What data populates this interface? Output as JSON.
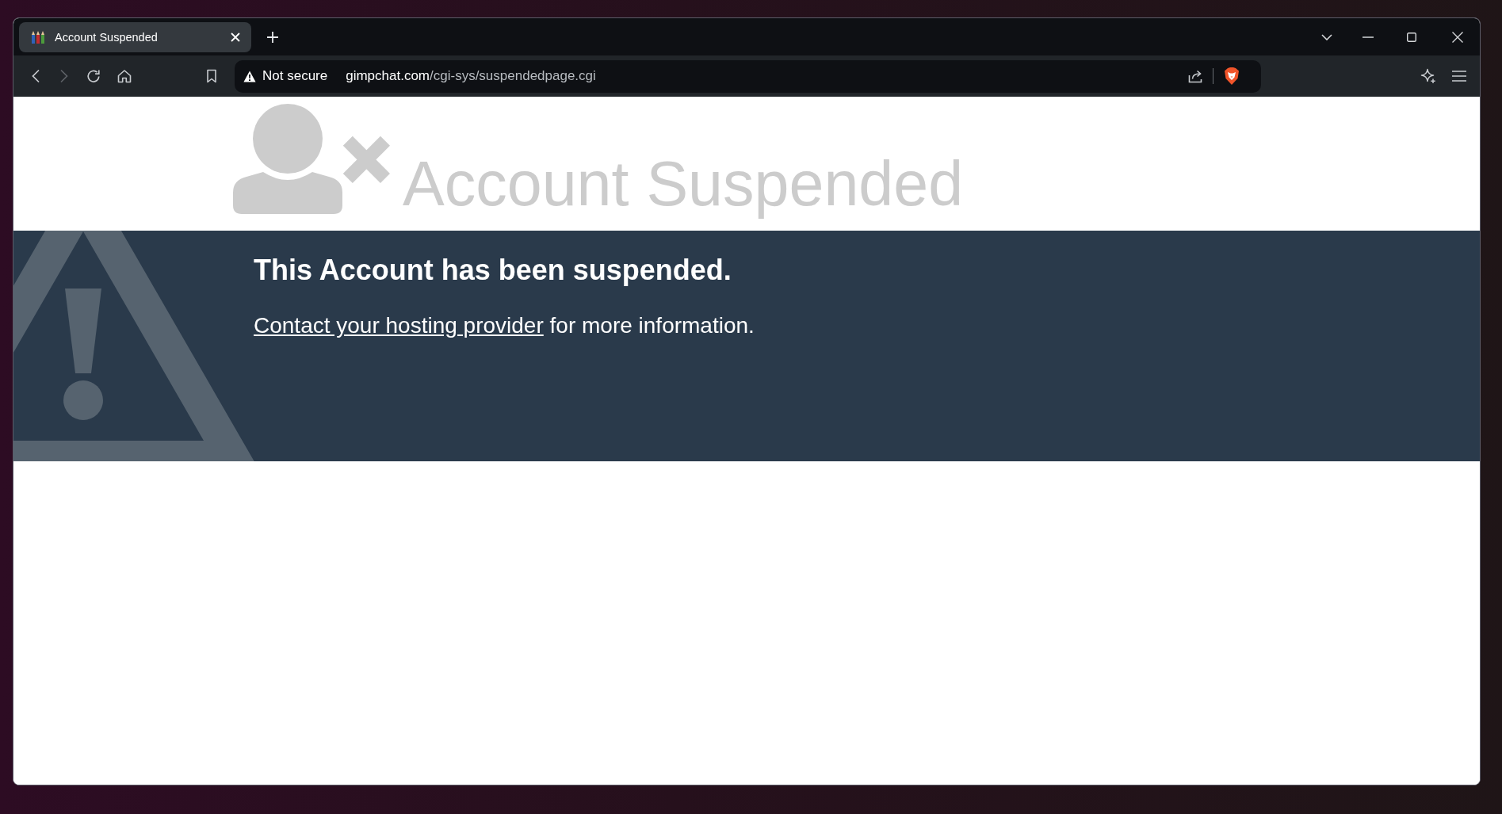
{
  "window": {
    "tabs": [
      {
        "title": "Account Suspended",
        "selected": true
      }
    ],
    "toolbar": {
      "nav_buttons": [
        {
          "kind": "back",
          "disabled": false
        },
        {
          "kind": "forward",
          "disabled": true
        },
        {
          "kind": "reload",
          "disabled": false
        },
        {
          "kind": "home",
          "disabled": false
        }
      ],
      "address_bar": {
        "security_label": "Not secure",
        "url_host": "gimpchat.com",
        "url_path": "/cgi-sys/suspendedpage.cgi"
      }
    }
  },
  "page": {
    "header": {
      "title": "Account Suspended"
    },
    "banner": {
      "heading": "This Account has been suspended.",
      "link": "Contact your hosting provider",
      "text": " for more information."
    }
  }
}
